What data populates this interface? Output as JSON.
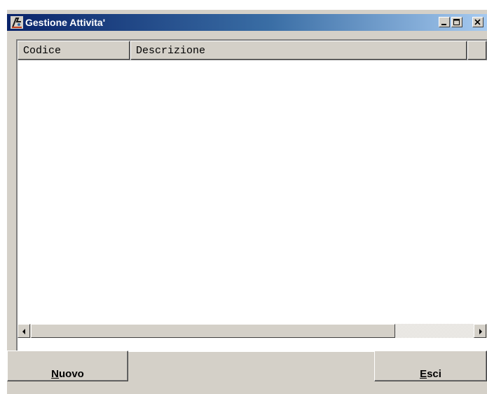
{
  "window": {
    "title": "Gestione Attivita'",
    "app_icon": "app-icon",
    "controls": [
      "minimize-icon",
      "maximize-icon",
      "close-icon"
    ]
  },
  "list": {
    "columns": [
      "Codice",
      "Descrizione"
    ],
    "rows": []
  },
  "buttons": {
    "nuovo": {
      "access_key": "N",
      "rest": "uovo"
    },
    "esci": {
      "access_key": "E",
      "rest": "sci"
    }
  },
  "colors": {
    "face": "#d4d0c8",
    "title_start": "#0a246a",
    "title_end": "#a6caf0"
  }
}
